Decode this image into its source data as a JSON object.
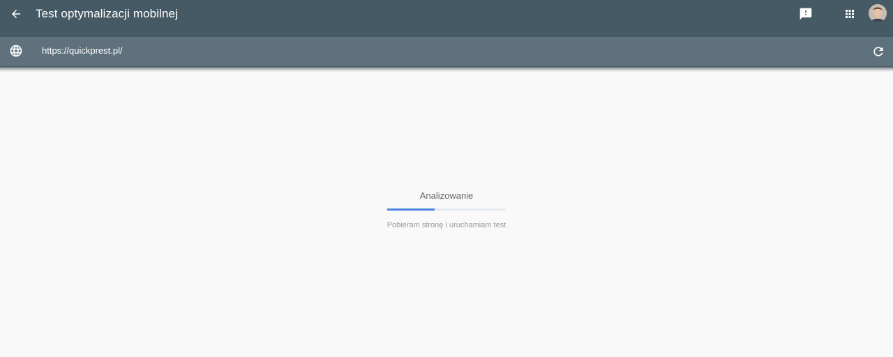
{
  "header": {
    "title": "Test optymalizacji mobilnej",
    "icons": {
      "back": "arrow-back-icon",
      "feedback": "feedback-icon",
      "apps": "apps-grid-icon",
      "avatar": "user-avatar"
    }
  },
  "url_bar": {
    "value": "https://quickprest.pl/",
    "icons": {
      "globe": "globe-icon",
      "reload": "reload-icon"
    }
  },
  "status": {
    "title": "Analizowanie",
    "subtitle": "Pobieram stronę i uruchamiam test",
    "progress": 0.4
  },
  "colors": {
    "header_bg": "#455a64",
    "urlbar_bg": "#5f717c",
    "progress": "#4c82e3",
    "background": "#f9f9f9"
  }
}
